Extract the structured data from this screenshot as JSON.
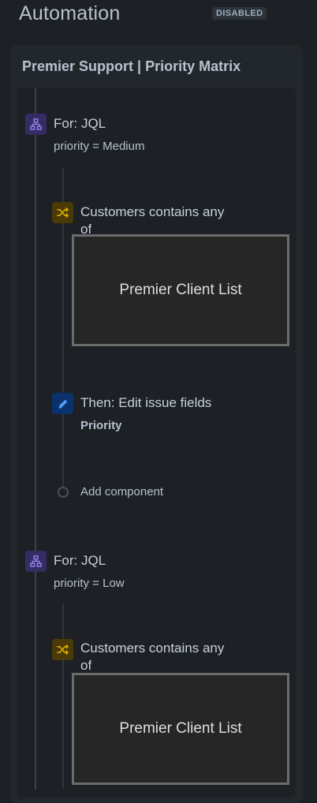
{
  "header": {
    "title": "Automation",
    "status": "DISABLED"
  },
  "rule": {
    "title": "Premier Support | Priority Matrix"
  },
  "branches": [
    {
      "title": "For: JQL",
      "query": "priority = Medium",
      "condition": {
        "line1": "Customers contains any",
        "line2": "of",
        "value": "Premier Client List"
      },
      "action": {
        "title": "Then: Edit issue fields",
        "field": "Priority"
      },
      "add_component": "Add component"
    },
    {
      "title": "For: JQL",
      "query": "priority = Low",
      "condition": {
        "line1": "Customers contains any",
        "line2": "of",
        "value": "Premier Client List"
      }
    }
  ],
  "colors": {
    "branch_icon": "#8f7ee7",
    "condition_icon": "#e2b203",
    "action_icon": "#579dff",
    "background": "#1d2125"
  },
  "icons": {
    "branch": "branch-icon",
    "condition": "shuffle-icon",
    "action": "pencil-icon"
  }
}
